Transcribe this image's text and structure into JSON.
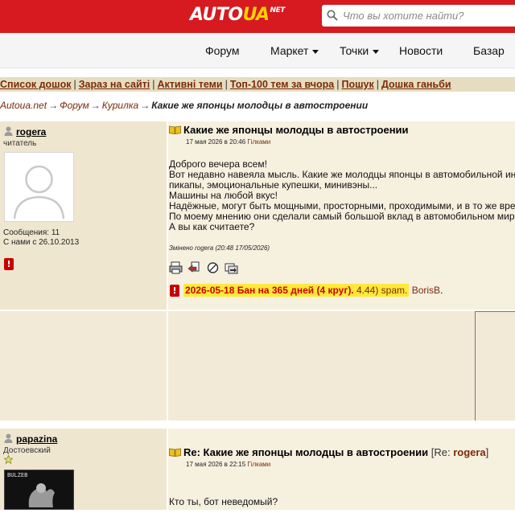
{
  "header": {
    "logo_a": "AUTO",
    "logo_b": "UA",
    "logo_c": "NET",
    "search_placeholder": "Что вы хотите найти?",
    "brand_color": "#d71920",
    "logo_accent": "#ffd200"
  },
  "nav": {
    "items": [
      {
        "label": "Форум",
        "dropdown": false
      },
      {
        "label": "Маркет",
        "dropdown": true
      },
      {
        "label": "Точки",
        "dropdown": true
      },
      {
        "label": "Новости",
        "dropdown": false
      },
      {
        "label": "Базар",
        "dropdown": false
      }
    ]
  },
  "links_bar": {
    "items": [
      "Список дошок",
      "Зараз на сайті",
      "Активні теми",
      "Топ-100 тем за вчора",
      "Пошук",
      "Дошка ганьби"
    ],
    "separator": "|"
  },
  "breadcrumb": {
    "items": [
      "Autoua.net",
      "Форум",
      "Курилка"
    ],
    "current": "Какие же японцы молодцы в автостроении",
    "arrow": "→"
  },
  "posts": [
    {
      "author": "rogera",
      "rank": "читатель",
      "messages": "Сообщения: 11",
      "joined": "С нами с 26.10.2013",
      "title": "Какие же японцы молодцы в автостроении",
      "date": "17 мая 2026 в 20:46",
      "board": "Гілками",
      "lines": [
        "Доброго вечера всем!",
        "Вот недавно навеяла мысль. Какие же молодцы японцы в автомобильной инд",
        "пикапы, эмоциональные купешки, минивэны...",
        "Машины на любой вкус!",
        "Надёжные, могут быть мощными, просторными, проходимыми, и в то же врем",
        "По моему мнению они сделали самый большой вклад в автомобильном мире",
        "А вы как считаете?"
      ],
      "changed": "Змінено rogera (20:48 17/05/2026)",
      "tools": [
        "print-icon",
        "reply-icon",
        "block-icon",
        "forward-icon"
      ],
      "ban": {
        "text": "2026-05-18 Бан на 365 дней (4 круг).",
        "reason": "4.44) spam.",
        "moderator": "BorisB",
        "end": "."
      }
    },
    {
      "author": "papazina",
      "rank": "Достоевский",
      "title": "Re: Какие же японцы молодцы в автостроении",
      "re_open": "[Re: ",
      "re_user": "rogera",
      "re_close": "]",
      "date": "17 мая 2026 в 22:15",
      "board": "Гілками",
      "lines": [
        "Кто ты, бот неведомый?"
      ],
      "avatar_text": "BULZEB"
    }
  ]
}
